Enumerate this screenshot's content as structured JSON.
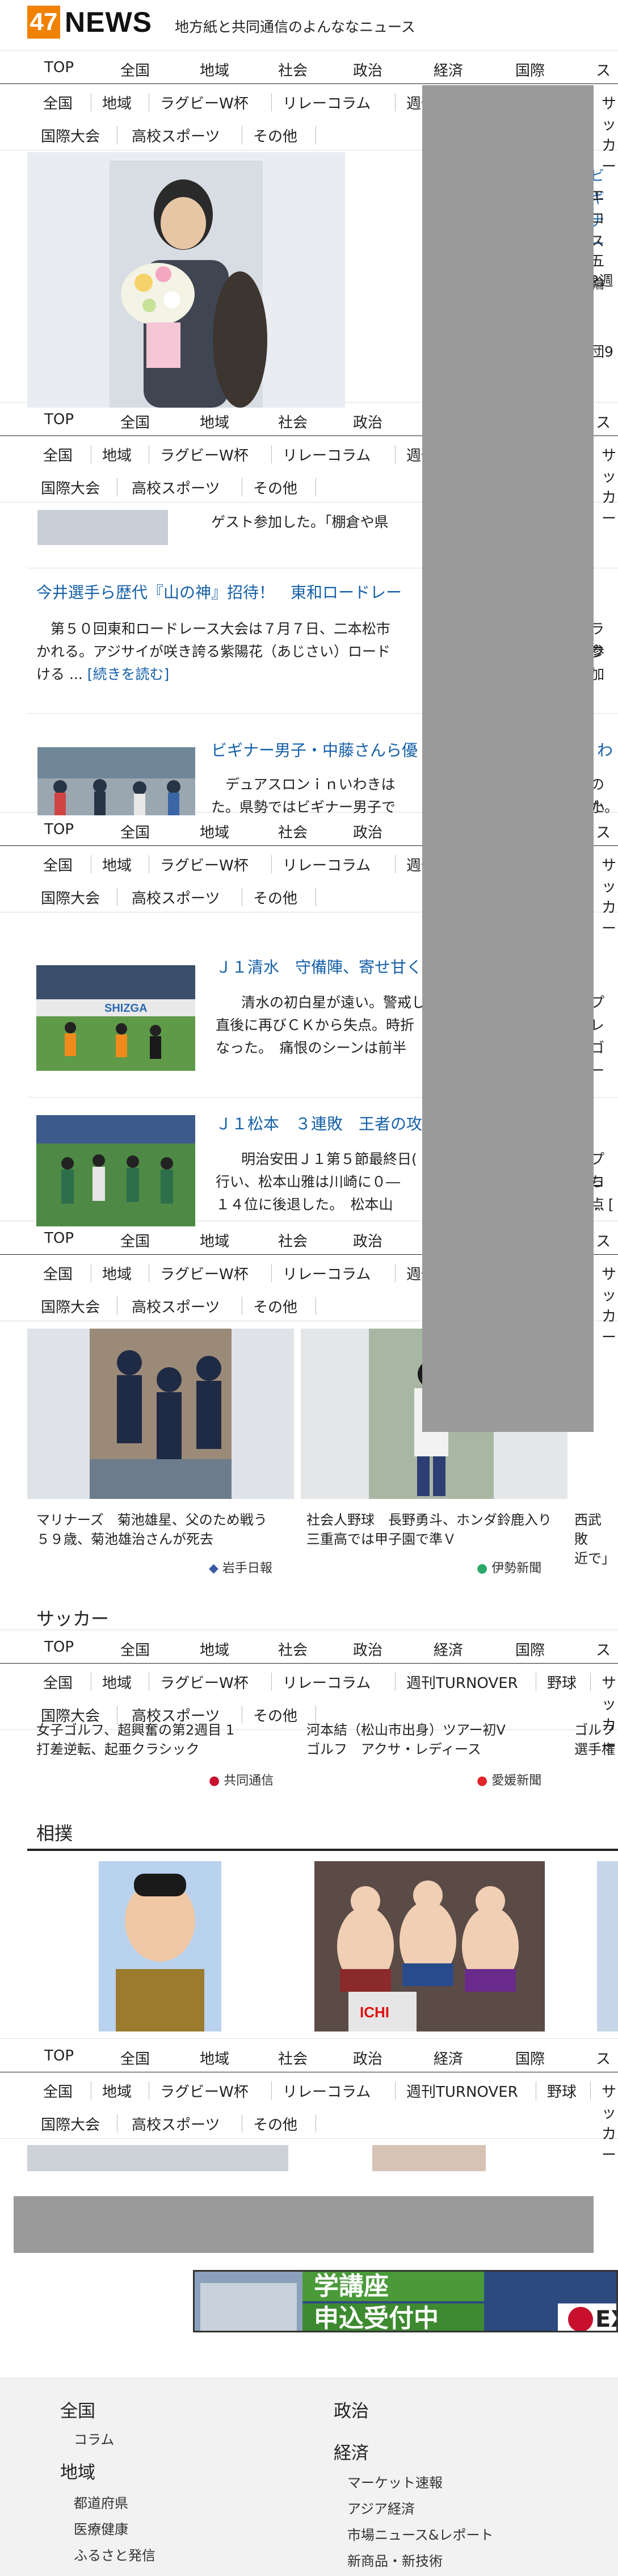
{
  "header": {
    "logo_num": "47",
    "logo_word": "NEWS",
    "tagline": "地方紙と共同通信のよんななニュース"
  },
  "nav": {
    "global": [
      "TOP",
      "全国",
      "地域",
      "社会",
      "政治",
      "経済",
      "国際",
      "スポーツ"
    ],
    "sub_row1": [
      "全国",
      "地域",
      "ラグビーW杯",
      "リレーコラム",
      "週刊TURNOVER",
      "野球",
      "サッカー"
    ],
    "sub_row2": [
      "国際大会",
      "高校スポーツ",
      "その他"
    ]
  },
  "articles": {
    "a1_right_text1": "ビギナー",
    "a1_right_text2": "エロス",
    "a1_right_text3": "五輪",
    "a1_right_text4": "2週",
    "a1_right_text5": "団9",
    "guest_text": "ゲスト参加した。「棚倉や県",
    "ai_headline": "今井選手ら歴代『山の神』招待！　東和ロードレー",
    "ai_body": "　第５０回東和ロードレース大会は７月７日、二本松市",
    "ai_body2": "かれる。アジサイが咲き誇る紫陽花（あじさい）ロード",
    "ai_body3": "ける ...",
    "ai_readmore": "[続きを読む]",
    "ai_right1": "ラウ",
    "ai_right2": "参加",
    "beginner_headline": "ビギナー男子・中藤さんら優",
    "beginner_right": "わ",
    "beginner_body": "　デュアスロンｉｎいわきは",
    "beginner_body2": "た。県勢ではビギナー男子で",
    "beginner_right2": "の小",
    "beginner_right3": "た。",
    "shimizu_headline": "Ｊ１清水　守備陣、寄せ甘く",
    "shimizu_body": "　清水の初白星が遠い。警戒し",
    "shimizu_body2": "直後に再びＣＫから失点。時折",
    "shimizu_body3": "なった。　痛恨のシーンは前半",
    "shimizu_right1": "プレ",
    "shimizu_right2": "ゴー",
    "matsumoto_headline": "Ｊ１松本　３連敗　王者の攻",
    "matsumoto_body": "　明治安田Ｊ１第５節最終日(",
    "matsumoto_body2": "行い、松本山雅は川崎に０―",
    "matsumoto_body3": "１４位に後退した。　松本山",
    "matsumoto_right1": "プロ",
    "matsumoto_right2": "ち点",
    "matsumoto_right3": "... [",
    "card1_caption": "マリナーズ　菊池雄星、父のため戦う　５９歳、菊池雄治さんが死去",
    "card1_source": "岩手日報",
    "card2_caption": "社会人野球　長野勇斗、ホンダ鈴鹿入り　三重高では甲子園で準Ｖ",
    "card2_source": "伊勢新聞",
    "card3_caption": "西武　敗　近で」",
    "soccer_title": "サッカー",
    "soccer_card1": "打差逆転、起亜クラシック",
    "soccer_card1_src": "共同通信",
    "soccer_card2": "ゴルフ　アクサ・レディース",
    "soccer_card2_src": "愛媛新聞",
    "soccer_card1_top": "女子ゴルフ、超興奮の第2週目 1",
    "soccer_card2_top": "河本結（松山市出身）ツアー初V",
    "soccer_card3_top": "ゴルフ",
    "soccer_card3": "選手権",
    "sumo_title": "相撲",
    "ad_text1": "申込受付中",
    "ad_text2": "学講座",
    "ad_text3": "EX"
  },
  "footer": {
    "col1": {
      "h1": "全国",
      "l1": "コラム",
      "h2": "地域",
      "l2": "都道府県",
      "l3": "医療健康",
      "l4": "ふるさと発信"
    },
    "col2": {
      "h1": "政治",
      "h2": "経済",
      "l1": "マーケット速報",
      "l2": "アジア経済",
      "l3": "市場ニュース&レポート",
      "l4": "新商品・新技術"
    }
  },
  "colors": {
    "brand": "#f08200",
    "link": "#1560a8",
    "accent": "#c8102e",
    "overlay": "#9a9a9a"
  }
}
